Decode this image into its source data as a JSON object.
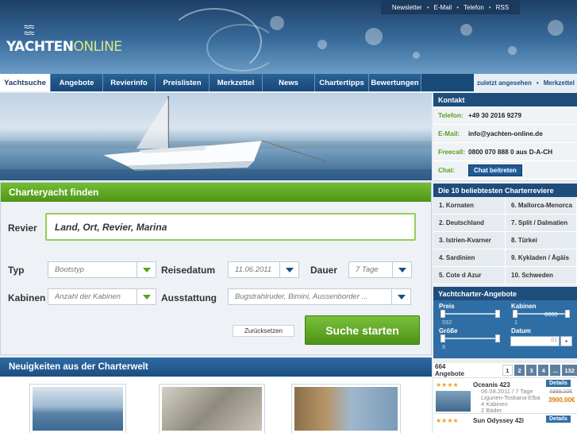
{
  "header": {
    "toplinks": [
      "Newsletter",
      "E-Mail",
      "Telefon",
      "RSS"
    ],
    "logo_main": "YACHTEN",
    "logo_accent": "ONLINE"
  },
  "nav": {
    "tabs": [
      {
        "label": "Yachtsuche",
        "active": true
      },
      {
        "label": "Angebote"
      },
      {
        "label": "Revierinfo"
      },
      {
        "label": "Preislisten"
      },
      {
        "label": "Merkzettel"
      },
      {
        "label": "News"
      },
      {
        "label": "Chartertipps"
      },
      {
        "label": "Bewertungen"
      }
    ],
    "right_links": [
      "zuletzt angesehen",
      "Merkzettel"
    ]
  },
  "kontakt": {
    "title": "Kontakt",
    "rows": [
      {
        "label": "Telefon:",
        "value": "+49 30 2016 9279"
      },
      {
        "label": "E-Mail:",
        "value": "info@yachten-online.de"
      },
      {
        "label": "Freecall:",
        "value": "0800 070 888 0 aus D-A-CH"
      },
      {
        "label": "Chat:",
        "value": "Chat beitreten"
      }
    ]
  },
  "reviere": {
    "title": "Die 10 beliebtesten Charterreviere",
    "items": [
      "1. Kornaten",
      "6. Mallorca-Menorca",
      "2. Deutschland",
      "7. Split / Dalmatien",
      "3. Istrien-Kvarner",
      "8. Türkei",
      "4. Sardinien",
      "9. Kykladen / Ägäis",
      "5. Cote d Azur",
      "10. Schweden"
    ]
  },
  "angebote": {
    "title": "Yachtcharter-Angebote",
    "preis_label": "Preis",
    "preis_min": "592",
    "kabinen_label": "Kabinen",
    "kabinen_min": "1",
    "kabinen_max": "6600",
    "groesse_label": "Größe",
    "groesse_min": "8",
    "datum_label": "Datum",
    "datum_value": "01"
  },
  "results": {
    "count": "664 Angebote",
    "pages": [
      "1",
      "2",
      "3",
      "4",
      "...",
      "132"
    ],
    "entries": [
      {
        "name": "Oceanis 423",
        "date": "06.08.2011 / 7 Tage",
        "region": "Ligurien-Toskana-Elba",
        "cabins": "4 Kabinen",
        "baths": "2 Bäder",
        "old_price": "4999,00€",
        "price": "3900,00€",
        "details": "Details"
      },
      {
        "name": "Sun Odyssey 42i",
        "details": "Details"
      }
    ]
  },
  "finder": {
    "title": "Charteryacht finden",
    "revier_label": "Revier",
    "revier_placeholder": "Land, Ort, Revier, Marina",
    "typ_label": "Typ",
    "typ_value": "Bootstyp",
    "reisedatum_label": "Reisedatum",
    "reisedatum_value": "11.06.2011",
    "dauer_label": "Dauer",
    "dauer_value": "7 Tage",
    "kabinen_label": "Kabinen",
    "kabinen_value": "Anzahl der Kabinen",
    "ausstattung_label": "Ausstattung",
    "ausstattung_value": "Bugstrahlruder, Bimini, Aussenborder ...",
    "reset_label": "Zurücksetzen",
    "search_label": "Suche starten"
  },
  "news": {
    "title": "Neuigkeiten aus der Charterwelt"
  },
  "colors": {
    "brand_blue": "#1e4d7c",
    "accent_green": "#5aa01f",
    "star": "#f0a020"
  }
}
